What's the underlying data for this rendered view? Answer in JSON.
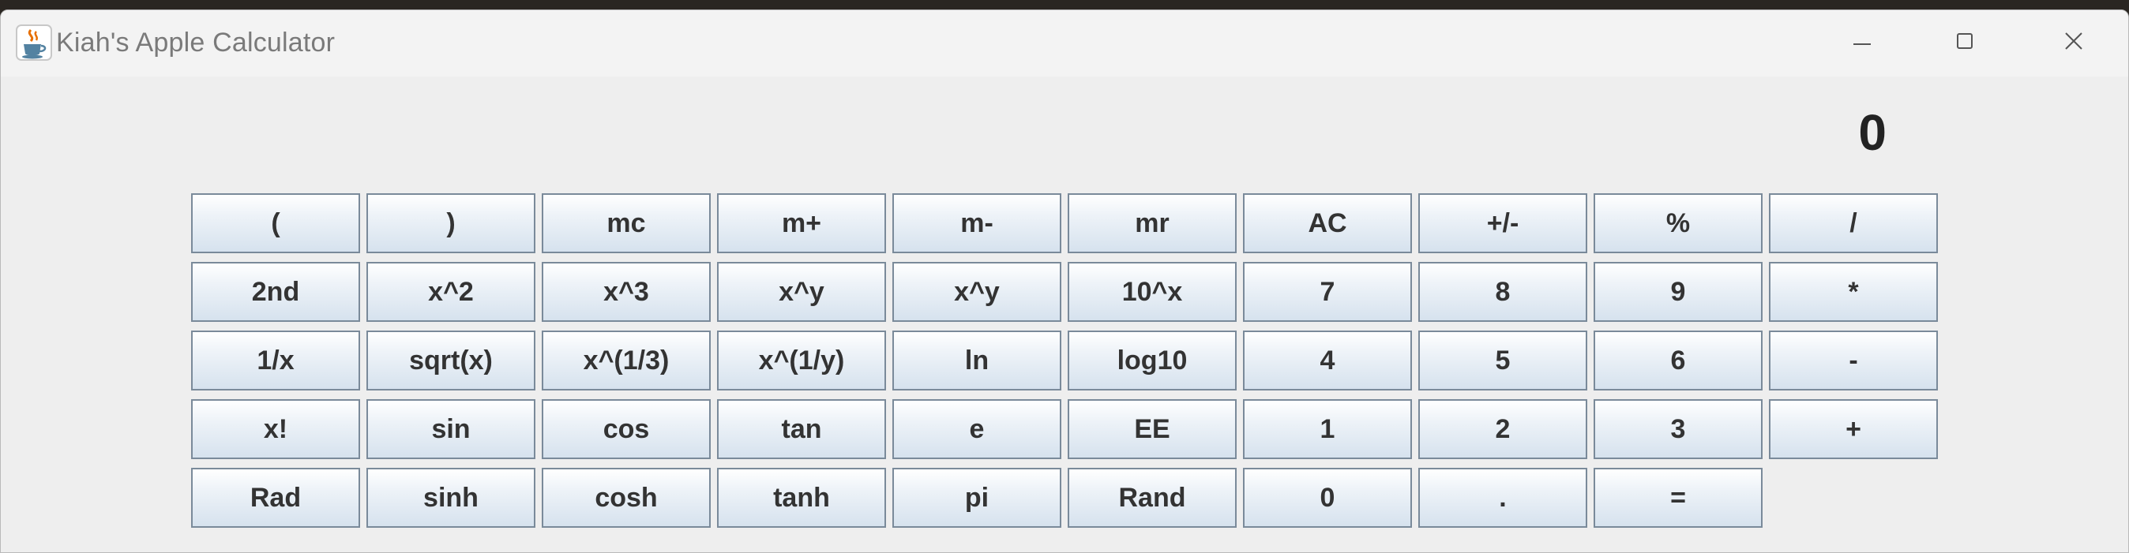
{
  "window": {
    "title": "Kiah's Apple Calculator",
    "app_icon": "java-coffee-icon",
    "controls": {
      "minimize_icon": "minimize-icon",
      "maximize_icon": "maximize-icon",
      "close_icon": "close-icon"
    }
  },
  "display": {
    "value": "0"
  },
  "keypad": {
    "rows": [
      [
        "(",
        ")",
        "mc",
        "m+",
        "m-",
        "mr",
        "AC",
        "+/-",
        "%",
        "/"
      ],
      [
        "2nd",
        "x^2",
        "x^3",
        "x^y",
        "x^y",
        "10^x",
        "7",
        "8",
        "9",
        "*"
      ],
      [
        "1/x",
        "sqrt(x)",
        "x^(1/3)",
        "x^(1/y)",
        "ln",
        "log10",
        "4",
        "5",
        "6",
        "-"
      ],
      [
        "x!",
        "sin",
        "cos",
        "tan",
        "e",
        "EE",
        "1",
        "2",
        "3",
        "+"
      ],
      [
        "Rad",
        "sinh",
        "cosh",
        "tanh",
        "pi",
        "Rand",
        "0",
        ".",
        "="
      ]
    ]
  },
  "colors": {
    "window_bg": "#eeeeee",
    "button_border": "#7a8a9a",
    "button_gradient_top": "#ffffff",
    "button_gradient_bottom": "#d6e2ee",
    "text": "#333333"
  }
}
